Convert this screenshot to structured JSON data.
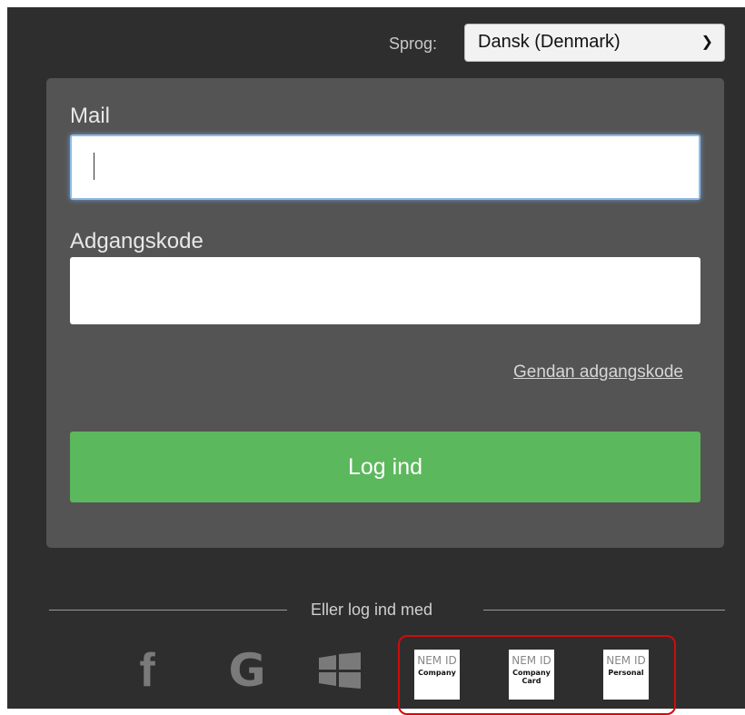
{
  "language": {
    "label": "Sprog:",
    "selected": "Dansk (Denmark)"
  },
  "login": {
    "mail_label": "Mail",
    "mail_value": "",
    "password_label": "Adgangskode",
    "password_value": "",
    "reset_link": "Gendan adgangskode",
    "submit_label": "Log ind"
  },
  "alt_login": {
    "divider_text": "Eller log ind med",
    "social": [
      {
        "icon": "facebook-icon",
        "glyph": "f"
      },
      {
        "icon": "google-icon",
        "glyph": "G"
      },
      {
        "icon": "windows-icon"
      }
    ],
    "nemid": [
      {
        "title": "NEM ID",
        "subtitle": "Company"
      },
      {
        "title": "NEM ID",
        "subtitle": "Company Card"
      },
      {
        "title": "NEM ID",
        "subtitle": "Personal"
      }
    ]
  },
  "colors": {
    "background": "#2e2e2e",
    "card": "#545454",
    "primary_button": "#5cb85c",
    "highlight_border": "#d20a0a"
  }
}
